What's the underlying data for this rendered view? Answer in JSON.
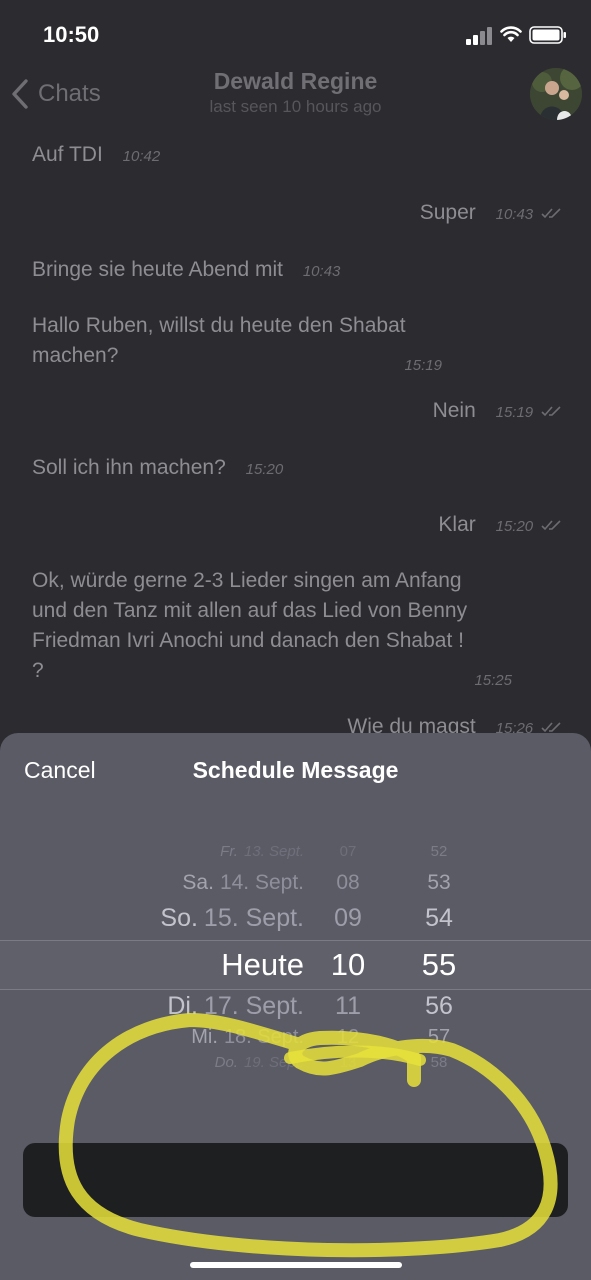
{
  "status_bar": {
    "time": "10:50"
  },
  "nav": {
    "back_label": "Chats",
    "title": "Dewald Regine",
    "subtitle": "last seen 10 hours ago"
  },
  "messages": [
    {
      "text": "Auf TDI",
      "time": "10:42",
      "direction": "in"
    },
    {
      "text": "Super",
      "time": "10:43",
      "direction": "out"
    },
    {
      "text": "Bringe sie heute Abend mit",
      "time": "10:43",
      "direction": "in"
    },
    {
      "lines": [
        "Hallo Ruben, willst du heute den Shabat",
        "machen?"
      ],
      "time": "15:19",
      "direction": "in"
    },
    {
      "text": "Nein",
      "time": "15:19",
      "direction": "out"
    },
    {
      "text": "Soll ich ihn machen?",
      "time": "15:20",
      "direction": "in"
    },
    {
      "text": "Klar",
      "time": "15:20",
      "direction": "out"
    },
    {
      "lines": [
        "Ok, würde gerne 2-3 Lieder singen am Anfang",
        "und den Tanz mit allen auf das Lied von Benny",
        "Friedman  Ivri Anochi und danach den Shabat !",
        "?"
      ],
      "time": "15:25",
      "direction": "in"
    },
    {
      "text": "Wie du magst",
      "time": "15:26",
      "direction": "out"
    }
  ],
  "sheet": {
    "cancel_label": "Cancel",
    "title": "Schedule Message",
    "picker": {
      "dates": [
        {
          "day": "Fr.",
          "date": "13. Sept."
        },
        {
          "day": "Sa.",
          "date": "14. Sept."
        },
        {
          "day": "So.",
          "date": "15. Sept."
        },
        {
          "day": "Heute",
          "date": ""
        },
        {
          "day": "Di.",
          "date": "17. Sept."
        },
        {
          "day": "Mi.",
          "date": "18. Sept."
        },
        {
          "day": "Do.",
          "date": "19. Sept."
        }
      ],
      "hours": [
        "07",
        "08",
        "09",
        "10",
        "11",
        "12",
        "13"
      ],
      "minutes": [
        "52",
        "53",
        "54",
        "55",
        "56",
        "57",
        "58"
      ],
      "selected": {
        "date": "Heute",
        "hour": "10",
        "minute": "55"
      }
    },
    "send_label": ""
  },
  "colors": {
    "background": "#2b2b30",
    "sheet": "#5b5b66",
    "button": "#1e1f20",
    "highlight_marker": "#e8e23a"
  },
  "icons": [
    "back-chevron-icon",
    "signal-icon",
    "wifi-icon",
    "battery-icon",
    "double-check-icon",
    "avatar-photo"
  ]
}
